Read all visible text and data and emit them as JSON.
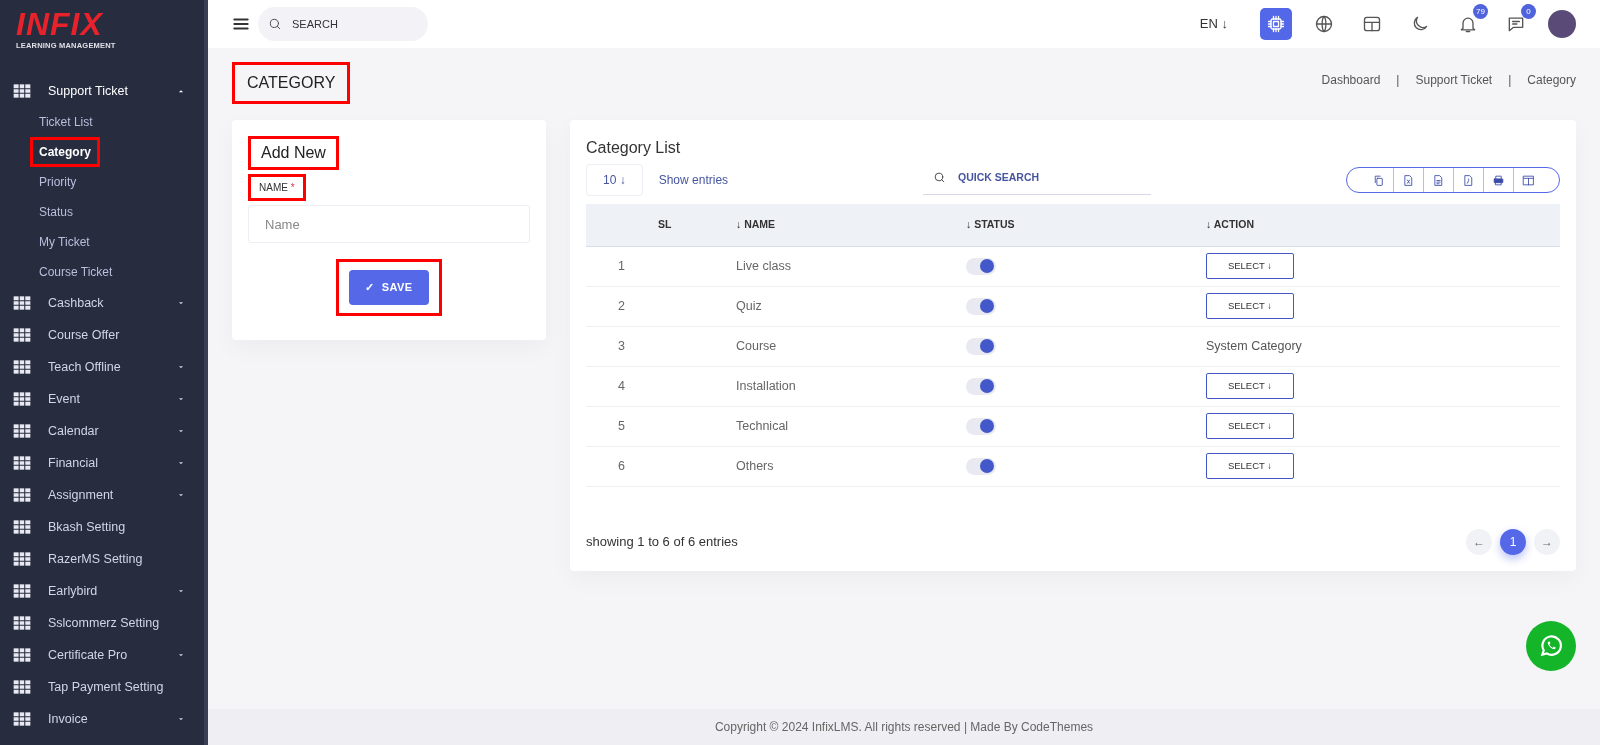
{
  "logo": {
    "title": "INFIX",
    "subtitle": "LEARNING MANAGEMENT"
  },
  "sidebar": {
    "items": [
      {
        "label": "Support Ticket",
        "kind": "submenu",
        "expanded": true,
        "children": [
          {
            "label": "Ticket List",
            "selected": false,
            "highlighted": false
          },
          {
            "label": "Category",
            "selected": true,
            "highlighted": true
          },
          {
            "label": "Priority",
            "selected": false,
            "highlighted": false
          },
          {
            "label": "Status",
            "selected": false,
            "highlighted": false
          },
          {
            "label": "My Ticket",
            "selected": false,
            "highlighted": false
          },
          {
            "label": "Course Ticket",
            "selected": false,
            "highlighted": false
          }
        ]
      },
      {
        "label": "Cashback",
        "kind": "submenu",
        "expanded": false
      },
      {
        "label": "Course Offer",
        "kind": "link"
      },
      {
        "label": "Teach Offline",
        "kind": "submenu",
        "expanded": false
      },
      {
        "label": "Event",
        "kind": "submenu",
        "expanded": false
      },
      {
        "label": "Calendar",
        "kind": "submenu",
        "expanded": false
      },
      {
        "label": "Financial",
        "kind": "submenu",
        "expanded": false
      },
      {
        "label": "Assignment",
        "kind": "submenu",
        "expanded": false
      },
      {
        "label": "Bkash Setting",
        "kind": "link"
      },
      {
        "label": "RazerMS Setting",
        "kind": "link"
      },
      {
        "label": "Earlybird",
        "kind": "submenu",
        "expanded": false
      },
      {
        "label": "Sslcommerz Setting",
        "kind": "link"
      },
      {
        "label": "Certificate Pro",
        "kind": "submenu",
        "expanded": false
      },
      {
        "label": "Tap Payment Setting",
        "kind": "link"
      },
      {
        "label": "Invoice",
        "kind": "submenu",
        "expanded": false
      }
    ]
  },
  "topbar": {
    "search": {
      "placeholder": "SEARCH"
    },
    "language": "EN ↓",
    "icons": [
      {
        "kind": "chip"
      },
      {
        "kind": "globe"
      },
      {
        "kind": "layout"
      },
      {
        "kind": "moon"
      },
      {
        "kind": "bell",
        "badge": "79"
      },
      {
        "kind": "chat",
        "badge": "0"
      },
      {
        "kind": "avatar"
      }
    ]
  },
  "page_title": {
    "text": "CATEGORY",
    "highlighted": true
  },
  "breadcrumb": {
    "separator": "|",
    "items": [
      "Dashboard",
      "Support Ticket",
      "Category"
    ]
  },
  "add_form": {
    "title": {
      "text": "Add New",
      "highlighted": true
    },
    "name_label": {
      "text": "NAME",
      "required_mark": "*",
      "highlighted": true
    },
    "name_field": {
      "placeholder": "Name"
    },
    "save_button": {
      "icon": "✓",
      "label": "SAVE",
      "highlighted": true
    }
  },
  "category_list": {
    "title": "Category List",
    "page_size": "10 ↓",
    "show_entries": "Show entries",
    "search": {
      "placeholder": "QUICK SEARCH"
    },
    "export_buttons": [
      {
        "kind": "copy"
      },
      {
        "kind": "excel"
      },
      {
        "kind": "csv"
      },
      {
        "kind": "pdf"
      },
      {
        "kind": "print"
      },
      {
        "kind": "columns"
      }
    ],
    "columns": [
      {
        "label": "SL"
      },
      {
        "label": "↓ NAME"
      },
      {
        "label": "↓ STATUS"
      },
      {
        "label": "↓ ACTION"
      }
    ],
    "rows": [
      {
        "sl": "1",
        "name": "Live class",
        "status_on": true,
        "action": {
          "kind": "button",
          "label": "SELECT ↓"
        }
      },
      {
        "sl": "2",
        "name": "Quiz",
        "status_on": true,
        "action": {
          "kind": "button",
          "label": "SELECT ↓"
        }
      },
      {
        "sl": "3",
        "name": "Course",
        "status_on": true,
        "action": {
          "kind": "text",
          "label": "System Category"
        }
      },
      {
        "sl": "4",
        "name": "Installation",
        "status_on": true,
        "action": {
          "kind": "button",
          "label": "SELECT ↓"
        }
      },
      {
        "sl": "5",
        "name": "Technical",
        "status_on": true,
        "action": {
          "kind": "button",
          "label": "SELECT ↓"
        }
      },
      {
        "sl": "6",
        "name": "Others",
        "status_on": true,
        "action": {
          "kind": "button",
          "label": "SELECT ↓"
        }
      }
    ],
    "summary": "showing 1 to 6 of 6 entries",
    "pagination": {
      "prev": "←",
      "pages": [
        {
          "label": "1",
          "selected": true
        }
      ],
      "next": "→"
    }
  },
  "footer": "Copyright © 2024 InfixLMS. All rights reserved | Made By CodeThemes"
}
